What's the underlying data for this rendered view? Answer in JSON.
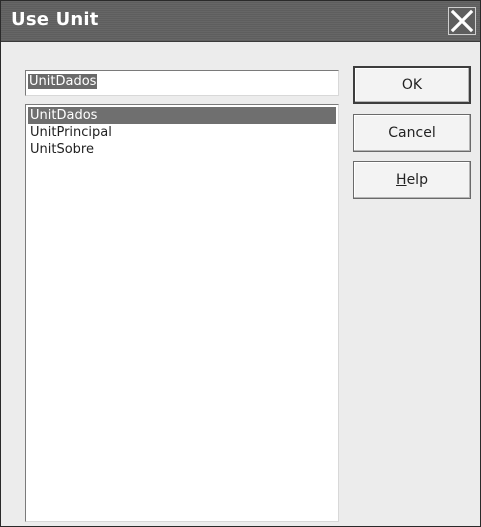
{
  "window": {
    "title": "Use Unit"
  },
  "unit_name": {
    "value": "UnitDados"
  },
  "unit_list": {
    "items": [
      {
        "label": "UnitDados",
        "selected": true
      },
      {
        "label": "UnitPrincipal",
        "selected": false
      },
      {
        "label": "UnitSobre",
        "selected": false
      }
    ]
  },
  "buttons": {
    "ok": "OK",
    "cancel": "Cancel",
    "help_mnemonic": "H",
    "help_rest": "elp"
  },
  "icons": {
    "close": "close-icon"
  }
}
